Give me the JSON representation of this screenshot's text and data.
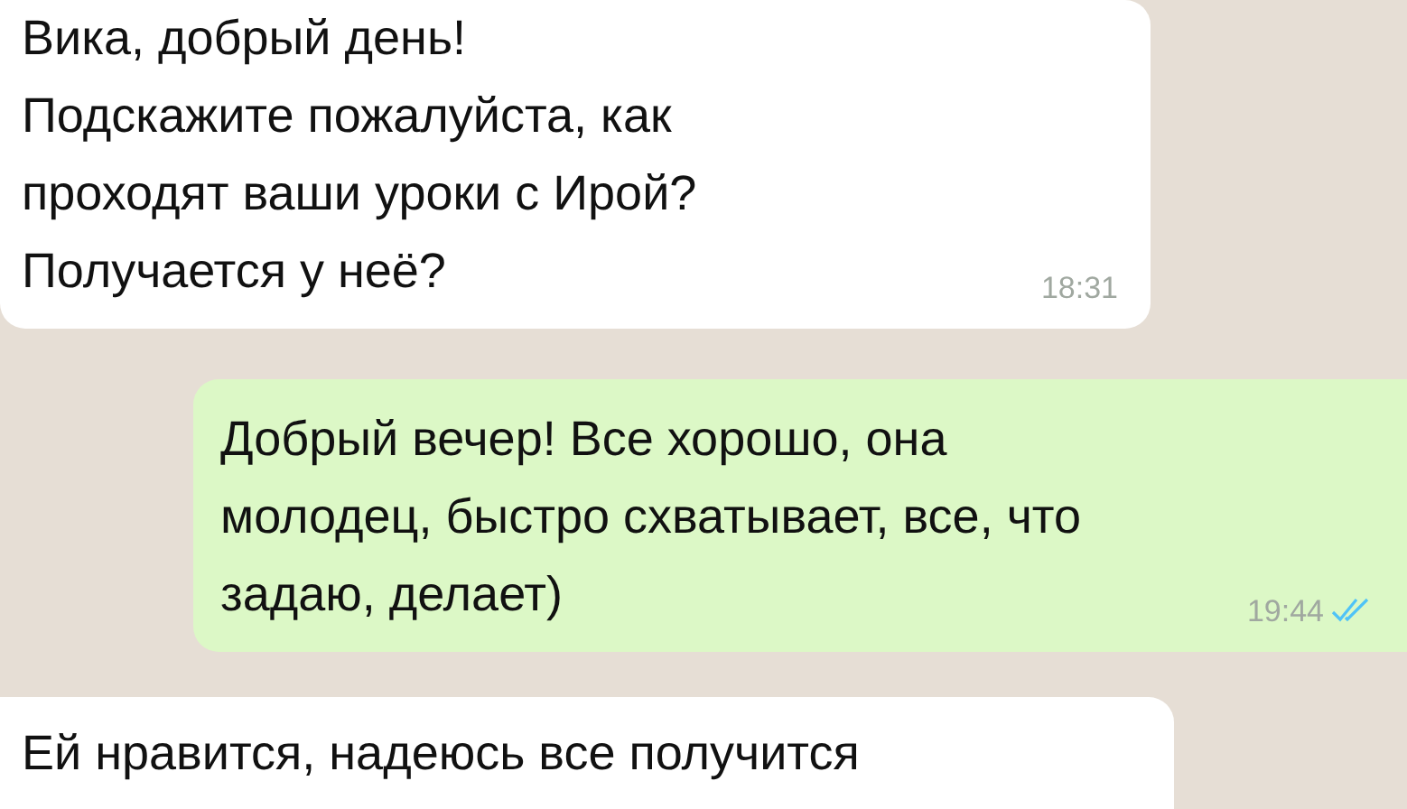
{
  "messages": [
    {
      "kind": "incoming",
      "text": "Вика, добрый день!\nПодскажите пожалуйста, как\nпроходят ваши уроки с Ирой?\nПолучается у неё?",
      "time": "18:31"
    },
    {
      "kind": "outgoing",
      "text": "Добрый вечер! Все хорошо, она\nмолодец, быстро схватывает, все, что\nзадаю, делает)",
      "time": "19:44",
      "read": true
    },
    {
      "kind": "incoming",
      "text": "Ей нравится, надеюсь все получится"
    }
  ]
}
